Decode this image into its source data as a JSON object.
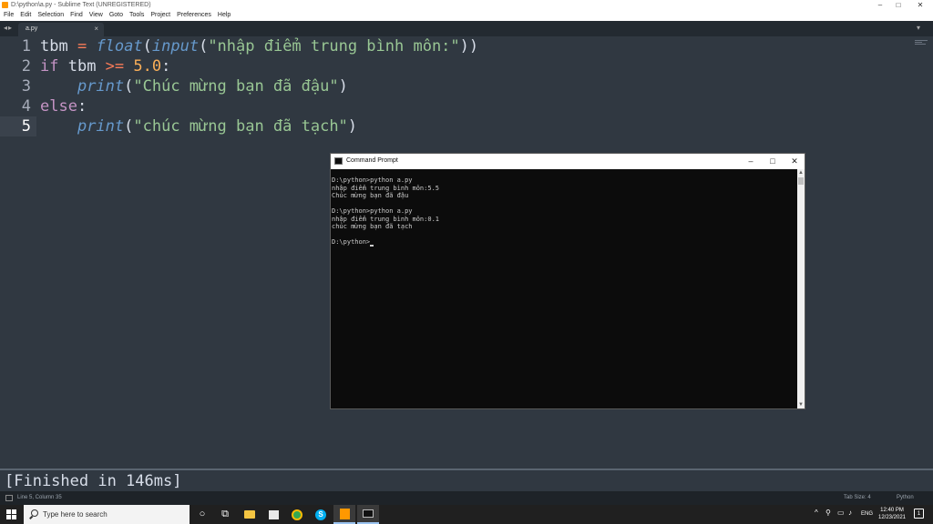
{
  "window": {
    "title": "D:\\python\\a.py - Sublime Text (UNREGISTERED)",
    "minimize": "–",
    "maximize": "□",
    "close": "✕"
  },
  "menu": [
    "File",
    "Edit",
    "Selection",
    "Find",
    "View",
    "Goto",
    "Tools",
    "Project",
    "Preferences",
    "Help"
  ],
  "tabs": {
    "nav": "◂▸",
    "active_tab": "a.py",
    "close": "×",
    "menu": "▾"
  },
  "editor": {
    "line_numbers": [
      "1",
      "2",
      "3",
      "4",
      "5"
    ],
    "active_line": 5,
    "code": {
      "l1": {
        "var": "tbm",
        "op": " = ",
        "fn1": "float",
        "p1": "(",
        "fn2": "input",
        "p2": "(",
        "str": "\"nhập điểm trung bình môn:\"",
        "p3": "))"
      },
      "l2": {
        "kw": "if",
        "sp": " tbm ",
        "op": ">=",
        "sp2": " ",
        "num": "5.0",
        "colon": ":"
      },
      "l3": {
        "indent": "    ",
        "fn": "print",
        "p1": "(",
        "str": "\"Chúc mừng bạn đã đậu\"",
        "p2": ")"
      },
      "l4": {
        "kw": "else",
        "colon": ":"
      },
      "l5": {
        "indent": "    ",
        "fn": "print",
        "p1": "(",
        "str": "\"chúc mừng bạn đã tạch\"",
        "p2": ")"
      }
    }
  },
  "cmd": {
    "title": "Command Prompt",
    "minimize": "–",
    "maximize": "□",
    "close": "✕",
    "lines": [
      "D:\\python>python a.py",
      "nhập điểm trung bình môn:5.5",
      "Chúc mừng bạn đã đậu",
      "",
      "D:\\python>python a.py",
      "nhập điểm trung bình môn:0.1",
      "chúc mừng bạn đã tạch",
      "",
      "D:\\python>"
    ],
    "scroll_up": "▲",
    "scroll_down": "▼"
  },
  "output": {
    "text": "[Finished in 146ms]"
  },
  "statusbar": {
    "position": "Line 5, Column 35",
    "tab_size": "Tab Size: 4",
    "syntax": "Python"
  },
  "taskbar": {
    "search_placeholder": "Type here to search",
    "language": "ENG",
    "time": "12:40 PM",
    "date": "12/23/2021",
    "notifications": "1"
  },
  "colors": {
    "editor_bg": "#303841",
    "keyword": "#c594c5",
    "function": "#6699cc",
    "string": "#99c794",
    "operator": "#f97b58",
    "number": "#f9ae58",
    "console_bg": "#0c0c0c"
  }
}
